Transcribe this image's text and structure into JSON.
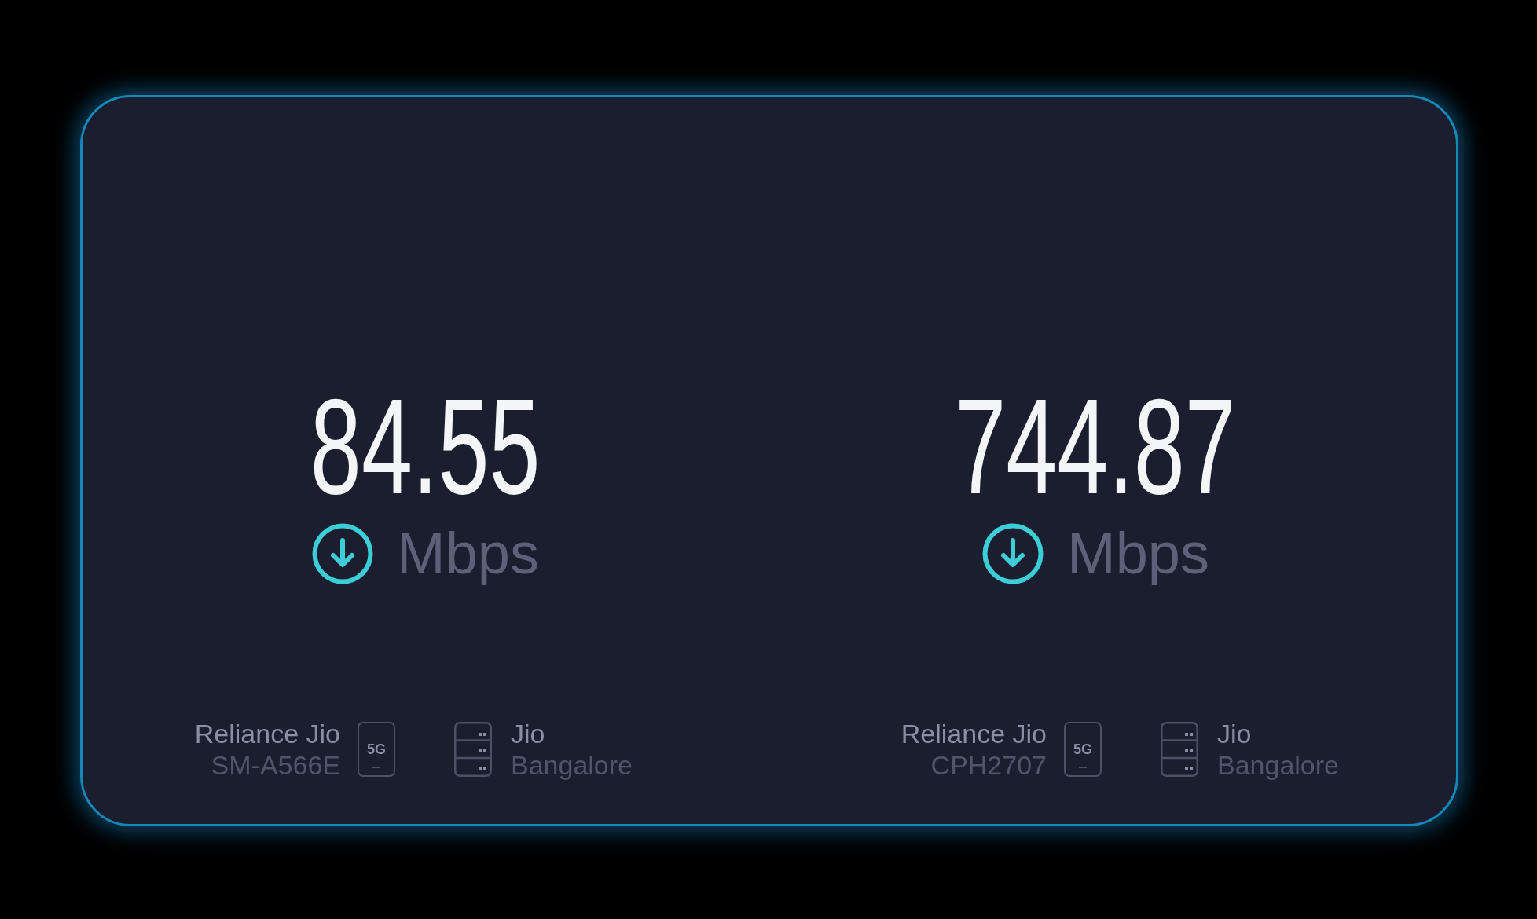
{
  "results": [
    {
      "speed": "84.55",
      "unit": "Mbps",
      "provider": "Reliance Jio",
      "device": "SM-A566E",
      "network_badge": "5G",
      "server_name": "Jio",
      "server_location": "Bangalore"
    },
    {
      "speed": "744.87",
      "unit": "Mbps",
      "provider": "Reliance Jio",
      "device": "CPH2707",
      "network_badge": "5G",
      "server_name": "Jio",
      "server_location": "Bangalore"
    }
  ]
}
